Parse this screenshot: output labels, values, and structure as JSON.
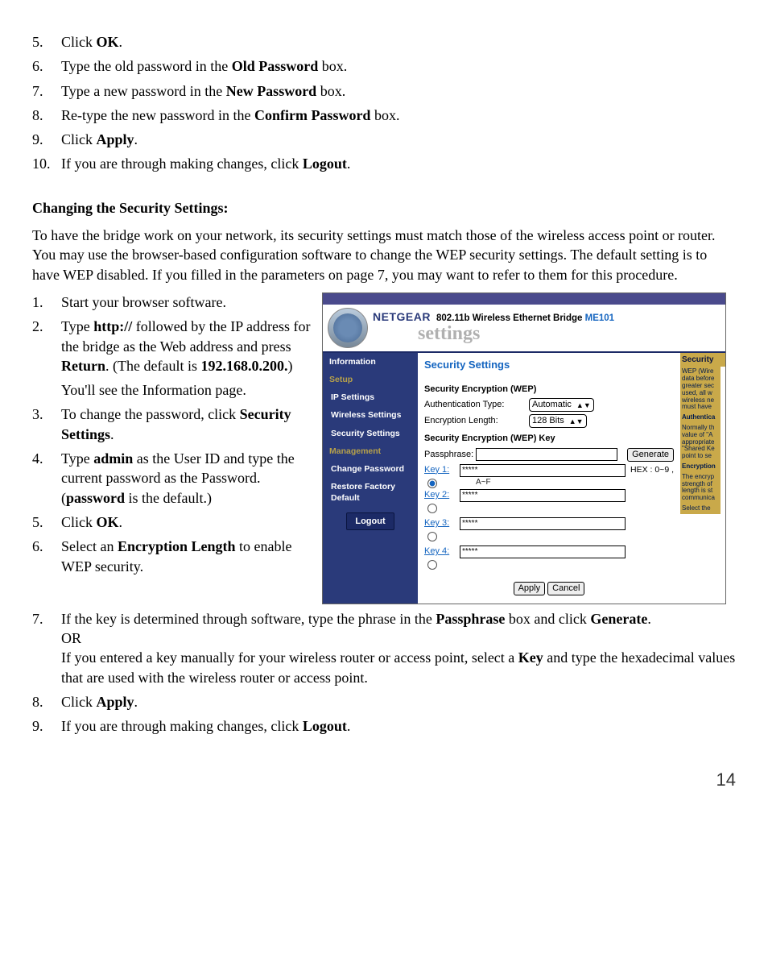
{
  "top_steps": [
    {
      "n": "5.",
      "html": "Click <b>OK</b>."
    },
    {
      "n": "6.",
      "html": "Type the old password in the <b>Old Password</b> box."
    },
    {
      "n": "7.",
      "html": "Type a new password in the <b>New Password</b> box."
    },
    {
      "n": "8.",
      "html": "Re-type the new password in the <b>Confirm Password</b> box."
    },
    {
      "n": "9.",
      "html": "Click <b>Apply</b>."
    },
    {
      "n": "10.",
      "html": "If you are through making changes, click <b>Logout</b>."
    }
  ],
  "section_heading": "Changing the Security Settings:",
  "intro": "To have the bridge work on your network, its security settings must match those of the wireless access point or router. You may use the browser-based configuration software to change the WEP security settings. The default setting is to have WEP disabled. If you filled in the parameters on page 7, you may want to refer to them for this procedure.",
  "left_steps": [
    {
      "n": "1.",
      "html": "Start your browser software."
    },
    {
      "n": "2.",
      "html": "Type <b>http://</b> followed by the IP address for the bridge as the Web address and press <b>Return</b>. (The default is <b>192.168.0.200.</b>)",
      "sub": "You'll see the Information page."
    },
    {
      "n": "3.",
      "html": "To change the password, click <b>Security Settings</b>."
    },
    {
      "n": "4.",
      "html": "Type <b>admin</b> as the User ID and type the current password as the Password. (<b>password</b> is the default.)"
    },
    {
      "n": "5.",
      "html": "Click <b>OK</b>."
    },
    {
      "n": "6.",
      "html": "Select an <b>Encryption Length</b> to enable WEP security."
    }
  ],
  "bottom_steps": [
    {
      "n": "7.",
      "html": "If the key is determined through software, type the phrase in the <b>Passphrase</b> box and click <b>Generate</b>.<br>OR<br>If you entered a key manually for your wireless router or access point, select a <b>Key</b> and type the hexadecimal values that are used with the wireless router or access point."
    },
    {
      "n": "8.",
      "html": "Click <b>Apply</b>."
    },
    {
      "n": "9.",
      "html": "If you are through making changes, click <b>Logout</b>."
    }
  ],
  "page_number": "14",
  "ng": {
    "brand": "NETGEAR",
    "title_a": "802.11b Wireless Ethernet Bridge ",
    "title_b": "ME101",
    "subtitle": "settings",
    "side": {
      "info": "Information",
      "cat1": "Setup",
      "ip": "IP Settings",
      "wireless": "Wireless Settings",
      "security": "Security Settings",
      "cat2": "Management",
      "chpw": "Change Password",
      "restore": "Restore Factory Default",
      "logout": "Logout"
    },
    "heading": "Security Settings",
    "sub1": "Security Encryption (WEP)",
    "auth_label": "Authentication Type:",
    "auth_value": "Automatic",
    "enc_label": "Encryption Length:",
    "enc_value": "128 Bits",
    "sub2": "Security Encryption (WEP) Key",
    "pass_label": "Passphrase:",
    "generate": "Generate",
    "hex": "HEX : 0~9 ,",
    "af": "A~F",
    "key1": "Key 1:",
    "key2": "Key 2:",
    "key3": "Key 3:",
    "key4": "Key 4:",
    "stars": "*****",
    "apply": "Apply",
    "cancel": "Cancel",
    "help_title": "Security",
    "help1": "WEP (Wire data before greater sec used, all w wireless ne must have",
    "help2": "Authentica",
    "help3": "Normally th value of \"A appropriate \"Shared Ke point to se",
    "help4": "Encryption",
    "help5": "The encryp strength of length is st communica",
    "help6": "Select the"
  }
}
